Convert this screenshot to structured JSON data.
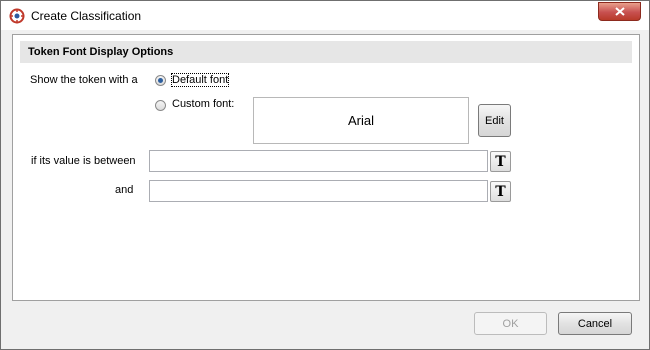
{
  "window": {
    "title": "Create Classification",
    "close_glyph": "✕"
  },
  "section": {
    "title": "Token Font Display Options"
  },
  "font_options": {
    "prompt": "Show the token with a",
    "default_label": "Default font",
    "custom_label": "Custom font:",
    "selected": "default",
    "preview_text": "Arial",
    "edit_label": "Edit"
  },
  "range": {
    "between_label": "if its value is between",
    "and_label": "and",
    "lower_value": "",
    "upper_value": "",
    "text_button_glyph": "T"
  },
  "footer": {
    "ok_label": "OK",
    "cancel_label": "Cancel"
  },
  "colors": {
    "accent": "#2d5f9f",
    "close_button": "#c75050",
    "section_header": "#e6e6e6"
  }
}
